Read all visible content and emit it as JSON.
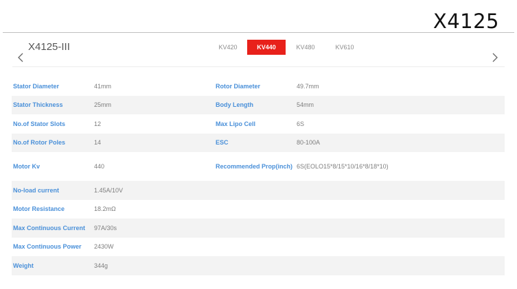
{
  "header": {
    "title": "X4125"
  },
  "product": {
    "model": "X4125-III"
  },
  "tabs": [
    {
      "label": "KV420",
      "active": false
    },
    {
      "label": "KV440",
      "active": true
    },
    {
      "label": "KV480",
      "active": false
    },
    {
      "label": "KV610",
      "active": false
    }
  ],
  "colors": {
    "accent": "#e8211b",
    "label": "#4a90d9",
    "stripe": "#f3f3f3"
  },
  "specs": [
    {
      "label": "Stator Diameter",
      "value": "41mm",
      "label2": "Rotor Diameter",
      "value2": "49.7mm"
    },
    {
      "label": "Stator Thickness",
      "value": "25mm",
      "label2": "Body Length",
      "value2": "54mm"
    },
    {
      "label": "No.of Stator Slots",
      "value": "12",
      "label2": "Max Lipo Cell",
      "value2": "6S"
    },
    {
      "label": "No.of Rotor Poles",
      "value": "14",
      "label2": "ESC",
      "value2": "80-100A"
    },
    {
      "label": "Motor Kv",
      "value": "440",
      "label2": "Recommended Prop(inch)",
      "value2": "6S(EOLO15*8/15*10/16*8/18*10)"
    },
    {
      "label": "No-load current",
      "value": "1.45A/10V",
      "label2": "",
      "value2": ""
    },
    {
      "label": "Motor Resistance",
      "value": "18.2mΩ",
      "label2": "",
      "value2": ""
    },
    {
      "label": "Max Continuous Current",
      "value": "97A/30s",
      "label2": "",
      "value2": ""
    },
    {
      "label": "Max Continuous Power",
      "value": "2430W",
      "label2": "",
      "value2": ""
    },
    {
      "label": "Weight",
      "value": "344g",
      "label2": "",
      "value2": ""
    }
  ],
  "icons": {
    "prev": "chevron-left-icon",
    "next": "chevron-right-icon"
  }
}
